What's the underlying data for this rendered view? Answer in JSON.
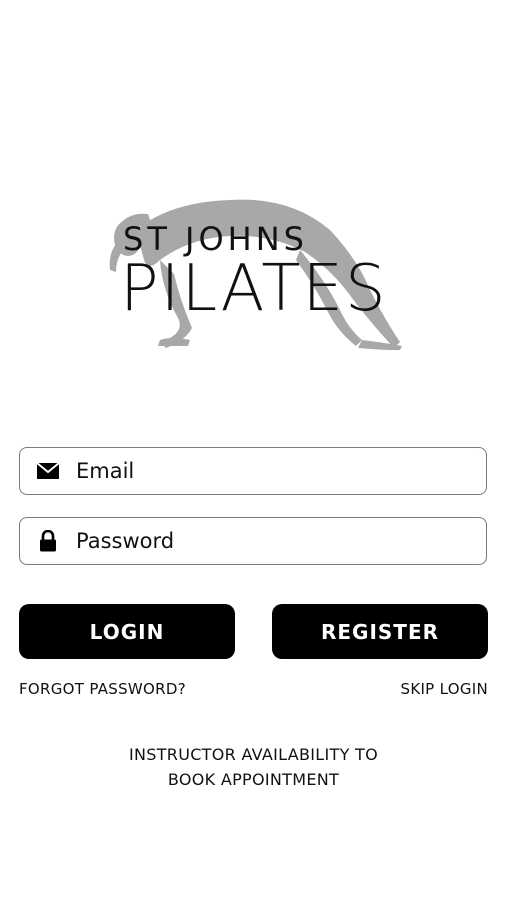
{
  "brand": {
    "line1": "ST JOHNS",
    "line2": "PILATES",
    "figure_icon": "pilates-pose-silhouette"
  },
  "form": {
    "email": {
      "placeholder": "Email",
      "value": "",
      "icon": "envelope-icon"
    },
    "password": {
      "placeholder": "Password",
      "value": "",
      "icon": "lock-icon"
    }
  },
  "buttons": {
    "login": "LOGIN",
    "register": "REGISTER"
  },
  "links": {
    "forgot_password": "FORGOT PASSWORD?",
    "skip_login": "SKIP LOGIN",
    "instructor_line1": "INSTRUCTOR AVAILABILITY TO",
    "instructor_line2": "BOOK APPOINTMENT"
  },
  "colors": {
    "background": "#ffffff",
    "button": "#000000",
    "button_text": "#ffffff",
    "figure": "#a6a6a6"
  }
}
